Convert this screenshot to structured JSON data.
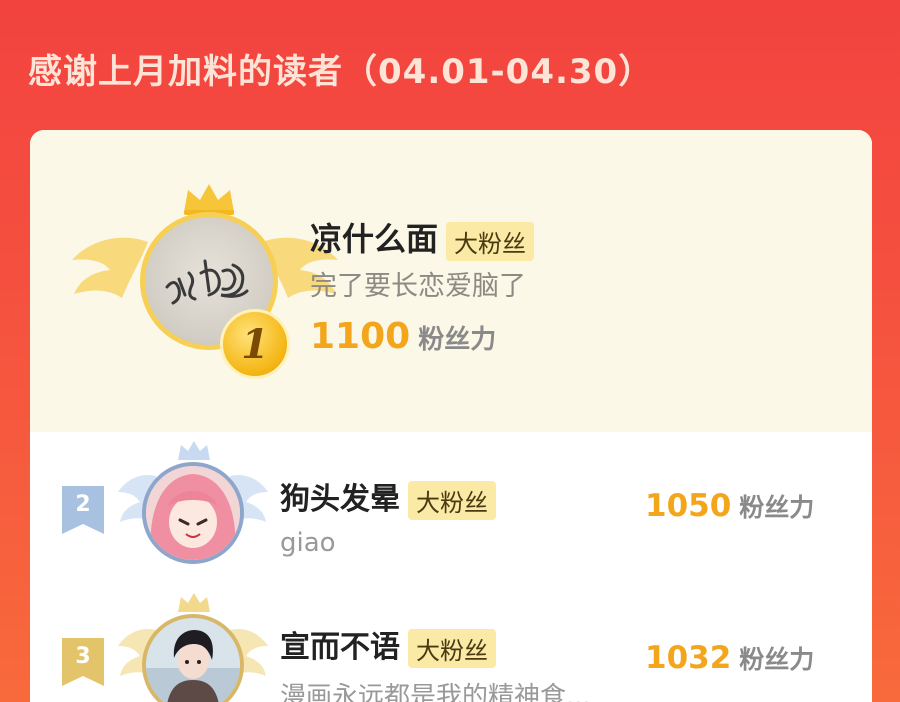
{
  "page": {
    "title": "感谢上月加料的读者（04.01-04.30）"
  },
  "colors": {
    "background": "#f2433f",
    "gold": "#f3a51c",
    "badge_bg": "#fbe9a6",
    "top_panel": "#fcf8e8"
  },
  "top_reader": {
    "rank": "1",
    "name": "凉什么面",
    "badge": "大粉丝",
    "message": "完了要长恋爱脑了",
    "score": "1100",
    "score_unit": "粉丝力",
    "avatar": "handwritten-signature-avatar"
  },
  "readers": [
    {
      "rank": "2",
      "name": "狗头发晕",
      "badge": "大粉丝",
      "message": "giao",
      "score": "1050",
      "score_unit": "粉丝力",
      "avatar": "pink-hair-anime-girl-avatar"
    },
    {
      "rank": "3",
      "name": "宣而不语",
      "badge": "大粉丝",
      "message": "漫画永远都是我的精神食...",
      "score": "1032",
      "score_unit": "粉丝力",
      "avatar": "dark-hair-anime-boy-avatar"
    }
  ]
}
